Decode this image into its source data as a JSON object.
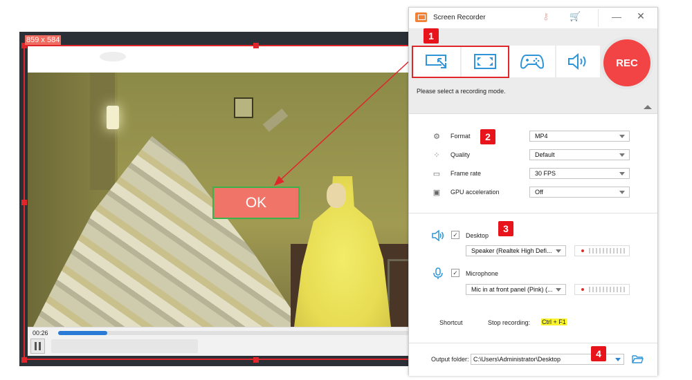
{
  "player": {
    "selection_size": "859 x 584",
    "ok_label": "OK",
    "time": "00:26",
    "progress_fraction": 0.14
  },
  "recorder": {
    "title": "Screen Recorder",
    "title_icons": [
      "key-icon",
      "cart-icon"
    ],
    "window_controls": {
      "minimize": "—",
      "close": "✕"
    },
    "modes": [
      {
        "name": "region-mode",
        "icon": "region-select-icon"
      },
      {
        "name": "fullscreen-mode",
        "icon": "fullscreen-icon"
      },
      {
        "name": "game-mode",
        "icon": "gamepad-icon"
      },
      {
        "name": "audio-mode",
        "icon": "speaker-icon"
      }
    ],
    "rec_label": "REC",
    "mode_hint": "Please select a recording mode.",
    "badges": [
      "1",
      "2",
      "3",
      "4"
    ],
    "settings": [
      {
        "icon": "format-icon",
        "label": "Format",
        "value": "MP4"
      },
      {
        "icon": "quality-icon",
        "label": "Quality",
        "value": "Default"
      },
      {
        "icon": "frame-rate-icon",
        "label": "Frame rate",
        "value": "30 FPS"
      },
      {
        "icon": "gpu-icon",
        "label": "GPU acceleration",
        "value": "Off"
      }
    ],
    "audio": {
      "desktop": {
        "label": "Desktop",
        "checked": true,
        "device": "Speaker (Realtek High Defi..."
      },
      "microphone": {
        "label": "Microphone",
        "checked": true,
        "device": "Mic in at front panel (Pink) (..."
      }
    },
    "shortcut": {
      "label": "Shortcut",
      "action": "Stop recording:",
      "keys": "Ctrl + F1"
    },
    "output": {
      "label": "Output folder:",
      "path": "C:\\Users\\Administrator\\Desktop"
    },
    "check_glyph": "✓"
  },
  "colors": {
    "accent_blue": "#2e95d8",
    "rec_red": "#f24444",
    "badge_red": "#e8141b",
    "highlight_yellow": "#f8f32a"
  }
}
